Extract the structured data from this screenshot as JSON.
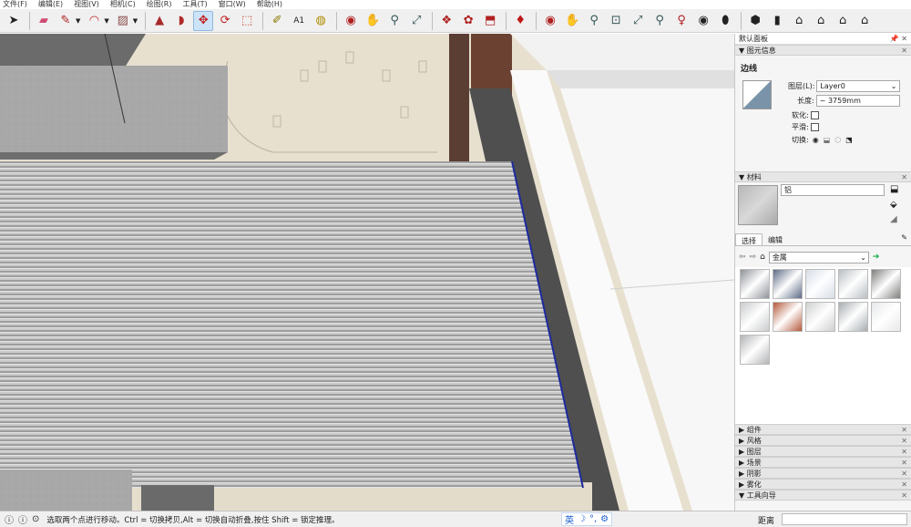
{
  "menu": [
    "文件(F)",
    "编辑(E)",
    "视图(V)",
    "相机(C)",
    "绘图(R)",
    "工具(T)",
    "窗口(W)",
    "帮助(H)"
  ],
  "tray": {
    "title": "默认面板",
    "entity_info": {
      "header": "图元信息",
      "entity_type": "边线",
      "layer_label": "图层(L):",
      "layer_value": "Layer0",
      "length_label": "长度:",
      "length_value": "~ 3759mm",
      "soften_label": "软化:",
      "smooth_label": "平滑:",
      "toggle_label": "切换:"
    },
    "materials": {
      "header": "材料",
      "name_value": "铝",
      "tab_select": "选择",
      "tab_edit": "编辑",
      "library_value": "金属",
      "swatch_colors": [
        "#8e9299",
        "#5d6a86",
        "#d6dde6",
        "#b9bec3",
        "#7d7f7c",
        "#c9cbcd",
        "#b5593b",
        "#cfd0d1",
        "#a7adb1",
        "#e7e8ea",
        "#b3b4b6"
      ]
    },
    "collapsed": [
      "组件",
      "风格",
      "图层",
      "场景",
      "阴影",
      "雾化",
      "工具向导"
    ]
  },
  "status": {
    "message": "选取两个点进行移动。Ctrl = 切换拷贝,Alt = 切换自动折叠,按住 Shift = 锁定推理。",
    "ime": "英",
    "measure_label": "距离"
  }
}
